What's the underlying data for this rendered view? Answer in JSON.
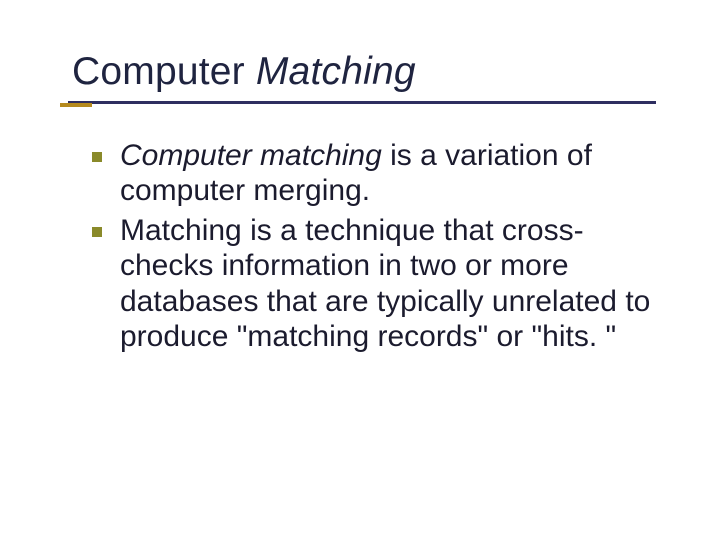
{
  "title": {
    "word1": "Computer ",
    "word2": "Matching"
  },
  "bullets": [
    {
      "emphasis": "Computer matching",
      "rest": " is a variation of computer merging."
    },
    {
      "text": "Matching is a technique that cross-checks information in two or more databases that are typically unrelated to produce \"matching records\" or \"hits. \""
    }
  ]
}
